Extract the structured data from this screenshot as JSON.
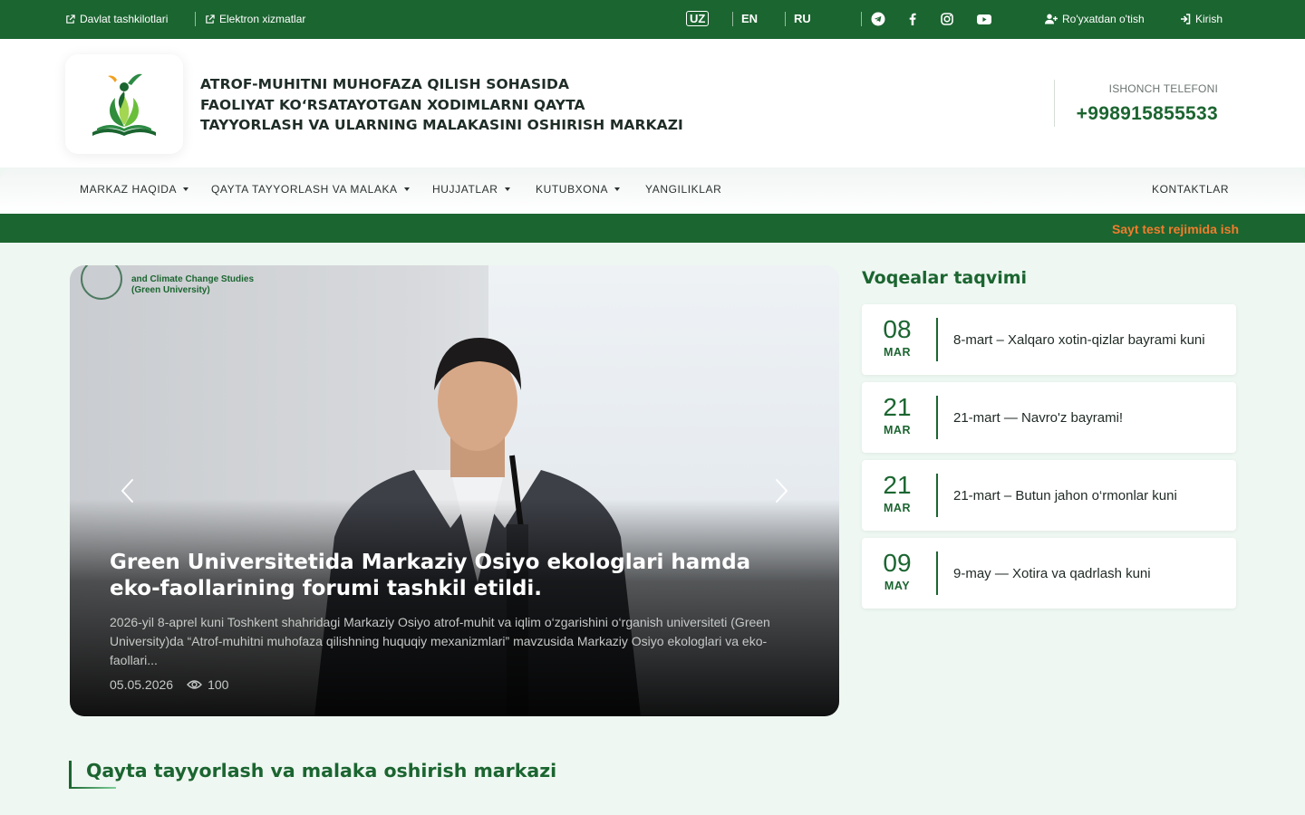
{
  "topbar": {
    "links": [
      {
        "label": "Davlat tashkilotlari"
      },
      {
        "label": "Elektron xizmatlar"
      }
    ],
    "languages": [
      "UZ",
      "EN",
      "RU"
    ],
    "active_language": "UZ",
    "social_icons": [
      "telegram-icon",
      "facebook-icon",
      "instagram-icon",
      "youtube-icon"
    ],
    "register_label": "Ro'yxatdan o'tish",
    "login_label": "Kirish"
  },
  "header": {
    "title_lines": [
      "ATROF-MUHITNI MUHOFAZA QILISH SOHASIDA",
      "FAOLIYAT KO‘RSATAYOTGAN XODIMLARNI QAYTA",
      "TAYYORLASH VA ULARNING MALAKASINI OSHIRISH MARKAZI"
    ],
    "hotline_label": "ISHONCH TELEFONI",
    "hotline_phone": "+998915855533"
  },
  "nav": {
    "items": [
      {
        "label": "MARKAZ HAQIDA",
        "dropdown": true
      },
      {
        "label": "QAYTA TAYYORLASH VA MALAKA",
        "dropdown": true
      },
      {
        "label": "HUJJATLAR",
        "dropdown": true
      },
      {
        "label": "KUTUBXONA",
        "dropdown": true
      },
      {
        "label": "YANGILIKLAR",
        "dropdown": false
      }
    ],
    "contacts_label": "KONTAKTLAR"
  },
  "ticker": {
    "text": "Sayt test rejimida ish"
  },
  "slider": {
    "logo_text_line1": "and Climate Change Studies",
    "logo_text_line2": "(Green University)",
    "title": "Green Universitetida Markaziy Osiyo ekologlari hamda eko-faollarining forumi tashkil etildi.",
    "excerpt": "2026-yil 8-aprel kuni Toshkent shahridagi Markaziy Osiyo atrof-muhit va iqlim o‘zgarishini o‘rganish universiteti (Green University)da “Atrof-muhitni muhofaza qilishning huquqiy mexanizmlari” mavzusida Markaziy Osiyo ekologlari va eko-faollari...",
    "date": "05.05.2026",
    "views": "100"
  },
  "events": {
    "title": "Voqealar taqvimi",
    "items": [
      {
        "day": "08",
        "month": "MAR",
        "text": "8-mart – Xalqaro xotin-qizlar bayrami kuni"
      },
      {
        "day": "21",
        "month": "MAR",
        "text": "21-mart — Navro'z bayrami!"
      },
      {
        "day": "21",
        "month": "MAR",
        "text": "21-mart – Butun jahon o‘rmonlar kuni"
      },
      {
        "day": "09",
        "month": "MAY",
        "text": "9-may — Xotira va qadrlash kuni"
      }
    ]
  },
  "section": {
    "title": "Qayta tayyorlash va malaka oshirish markazi"
  },
  "colors": {
    "primary": "#1b6530",
    "ticker_text": "#f07d2c",
    "page_bg": "#eef7f1"
  }
}
